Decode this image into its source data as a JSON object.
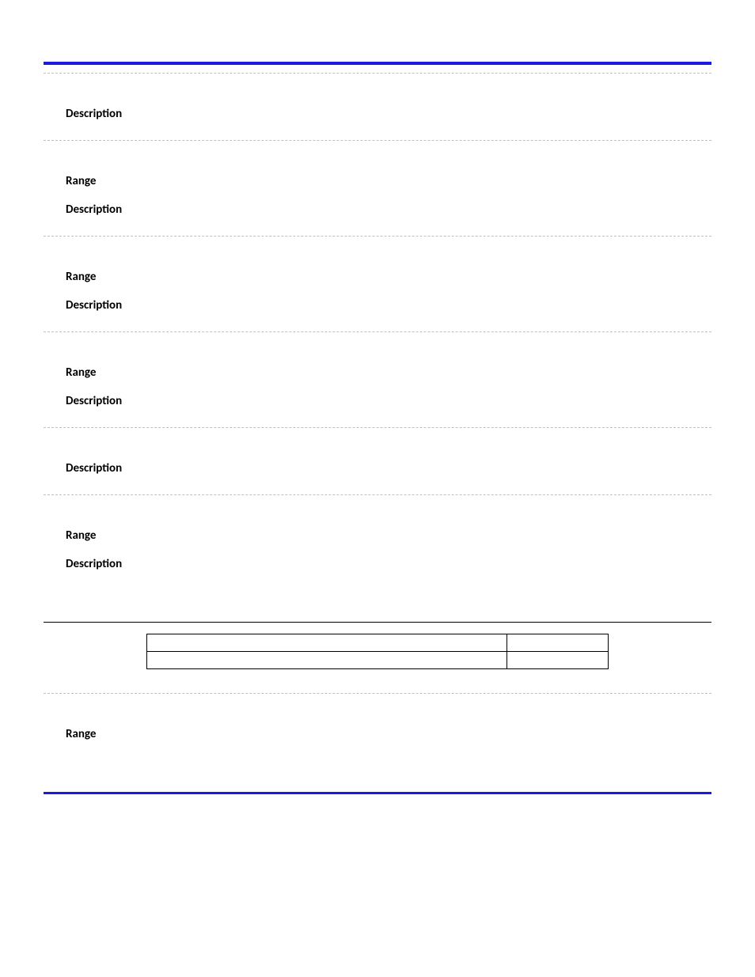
{
  "labels": {
    "range": "Range",
    "description": "Description"
  },
  "sections": [
    {
      "fields": [
        "description"
      ]
    },
    {
      "fields": [
        "range",
        "description"
      ]
    },
    {
      "fields": [
        "range",
        "description"
      ]
    },
    {
      "fields": [
        "range",
        "description"
      ]
    },
    {
      "fields": [
        "description"
      ]
    },
    {
      "fields": [
        "range",
        "description"
      ]
    }
  ],
  "table": {
    "rows": [
      {
        "c1": "",
        "c2": ""
      },
      {
        "c1": "",
        "c2": ""
      }
    ]
  },
  "tail_section": {
    "fields": [
      "range"
    ]
  }
}
